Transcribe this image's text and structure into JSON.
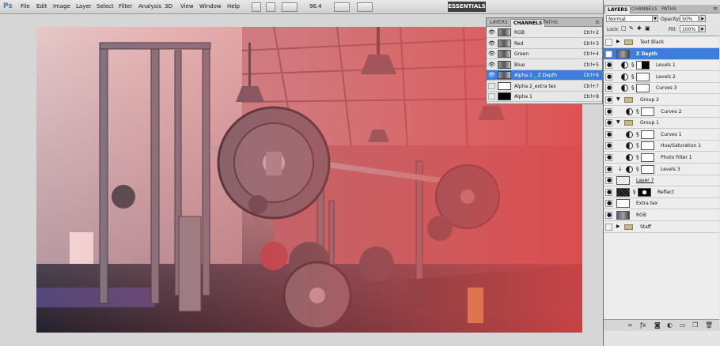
{
  "app": {
    "logo": "Ps"
  },
  "menubar": {
    "items": [
      "File",
      "Edit",
      "Image",
      "Layer",
      "Select",
      "Filter",
      "Analysis",
      "3D",
      "View",
      "Window",
      "Help"
    ],
    "zoom": "96.4",
    "workspace": "ESSENTIALS",
    "workspace_arrow": "»"
  },
  "channels_panel": {
    "tabs": [
      "LAYERS",
      "CHANNELS",
      "PATHS"
    ],
    "active_tab": "CHANNELS",
    "menu_icon": "≡",
    "rows": [
      {
        "name": "RGB",
        "shortcut": "Ctrl+2",
        "visible": true,
        "thumb": "photo",
        "selected": false
      },
      {
        "name": "Red",
        "shortcut": "Ctrl+3",
        "visible": true,
        "thumb": "photo",
        "selected": false
      },
      {
        "name": "Green",
        "shortcut": "Ctrl+4",
        "visible": true,
        "thumb": "photo",
        "selected": false
      },
      {
        "name": "Blue",
        "shortcut": "Ctrl+5",
        "visible": true,
        "thumb": "photo",
        "selected": false
      },
      {
        "name": "Alpha 1 _ Z Depth",
        "shortcut": "Ctrl+6",
        "visible": true,
        "thumb": "photo",
        "selected": true
      },
      {
        "name": "Alpha 2_extra tex",
        "shortcut": "Ctrl+7",
        "visible": false,
        "thumb": "white",
        "selected": false
      },
      {
        "name": "Alpha 1",
        "shortcut": "Ctrl+8",
        "visible": false,
        "thumb": "black",
        "selected": false
      }
    ]
  },
  "layers_panel": {
    "tabs": [
      "LAYERS",
      "CHANNELS",
      "PATHS"
    ],
    "active_tab": "LAYERS",
    "menu_icon": "≡",
    "blend_mode": "Normal",
    "opacity_label": "Opacity:",
    "opacity": "50%",
    "lock_label": "Lock:",
    "fill_label": "Fill:",
    "fill": "100%",
    "layers": [
      {
        "name": "Text Black",
        "kind": "group",
        "indent": 0,
        "visible": false,
        "expanded": false,
        "selected": false
      },
      {
        "name": "Z Depth",
        "kind": "pixel",
        "indent": 0,
        "visible": true,
        "selected": true,
        "thumb": "photo"
      },
      {
        "name": "Levels 1",
        "kind": "adjustment",
        "indent": 0,
        "visible": true,
        "selected": false,
        "mask": "black-white"
      },
      {
        "name": "Levels 2",
        "kind": "adjustment",
        "indent": 0,
        "visible": true,
        "selected": false,
        "mask": "white"
      },
      {
        "name": "Curves 3",
        "kind": "adjustment",
        "indent": 0,
        "visible": true,
        "selected": false,
        "mask": "white"
      },
      {
        "name": "Group 2",
        "kind": "group",
        "indent": 0,
        "visible": true,
        "expanded": true,
        "selected": false
      },
      {
        "name": "Curves 2",
        "kind": "adjustment",
        "indent": 1,
        "visible": true,
        "selected": false,
        "mask": "white"
      },
      {
        "name": "Group 1",
        "kind": "group",
        "indent": 0,
        "visible": true,
        "expanded": true,
        "selected": false
      },
      {
        "name": "Curves 1",
        "kind": "adjustment",
        "indent": 1,
        "visible": true,
        "selected": false,
        "mask": "white"
      },
      {
        "name": "Hue/Saturation 1",
        "kind": "adjustment",
        "indent": 1,
        "visible": true,
        "selected": false,
        "mask": "white"
      },
      {
        "name": "Photo Filter 1",
        "kind": "adjustment",
        "indent": 1,
        "visible": true,
        "selected": false,
        "mask": "white"
      },
      {
        "name": "Levels 3",
        "kind": "adjustment",
        "indent": 1,
        "visible": true,
        "selected": false,
        "mask": "white",
        "clipped": true
      },
      {
        "name": "Layer 7",
        "kind": "pixel",
        "indent": 0,
        "visible": true,
        "selected": false,
        "thumb": "transparent",
        "underline": true
      },
      {
        "name": "Reflect",
        "kind": "pixel",
        "indent": 0,
        "visible": true,
        "selected": false,
        "thumb": "dark-speckle",
        "mask": "black-white"
      },
      {
        "name": "Extra tex",
        "kind": "pixel",
        "indent": 0,
        "visible": true,
        "selected": false,
        "thumb": "white"
      },
      {
        "name": "RGB",
        "kind": "pixel",
        "indent": 0,
        "visible": true,
        "selected": false,
        "thumb": "photo"
      },
      {
        "name": "Staff",
        "kind": "group",
        "indent": 0,
        "visible": false,
        "expanded": false,
        "selected": false
      }
    ],
    "footer_icons": [
      "link-icon",
      "fx-icon",
      "mask-icon",
      "adjustment-icon",
      "folder-icon",
      "new-layer-icon",
      "trash-icon"
    ]
  },
  "colors": {
    "selection_blue": "#3d7ddb",
    "panel_bg": "#e4e4e4",
    "chrome": "#d6d6d6",
    "red_overlay": "#e05555"
  }
}
